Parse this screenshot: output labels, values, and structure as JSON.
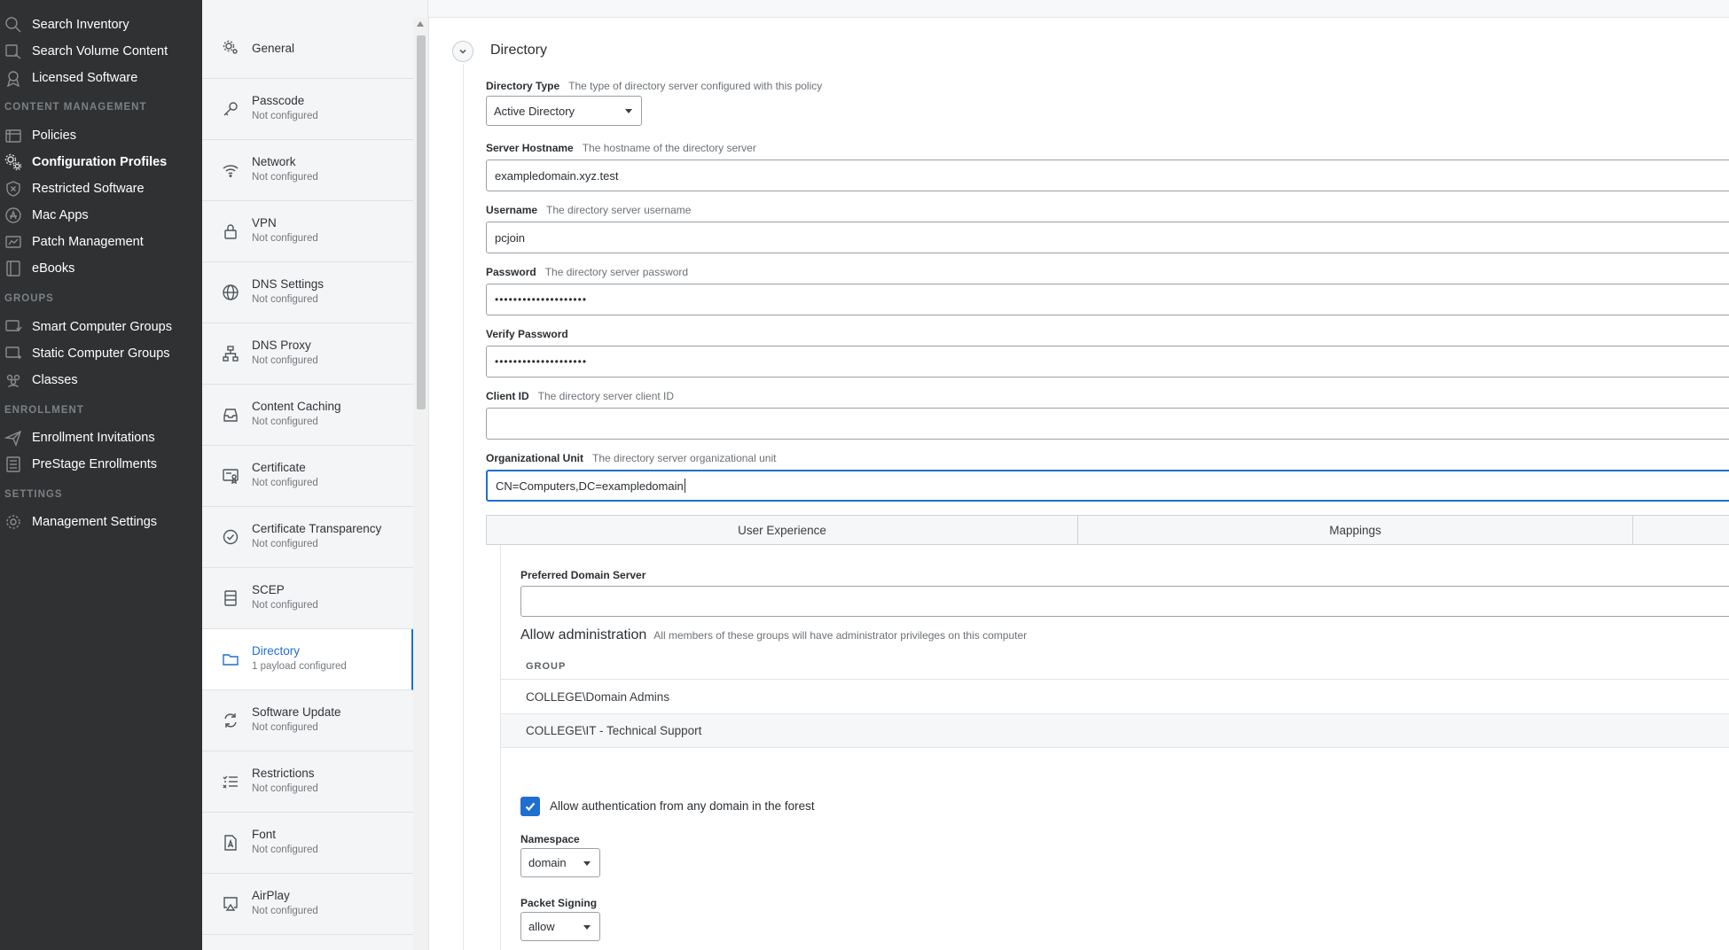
{
  "nav": {
    "items_top": [
      {
        "label": "Search Inventory",
        "icon": "search-icon"
      },
      {
        "label": "Search Volume Content",
        "icon": "search-volume-icon"
      },
      {
        "label": "Licensed Software",
        "icon": "license-icon"
      }
    ],
    "sections": [
      {
        "title": "CONTENT MANAGEMENT"
      },
      {
        "title": "GROUPS"
      },
      {
        "title": "ENROLLMENT"
      },
      {
        "title": "SETTINGS"
      }
    ],
    "content_management": [
      {
        "label": "Policies",
        "icon": "policies-icon"
      },
      {
        "label": "Configuration Profiles",
        "icon": "gears-icon",
        "active": true
      },
      {
        "label": "Restricted Software",
        "icon": "shield-x-icon"
      },
      {
        "label": "Mac Apps",
        "icon": "app-store-icon"
      },
      {
        "label": "Patch Management",
        "icon": "patch-icon"
      },
      {
        "label": "eBooks",
        "icon": "book-icon"
      }
    ],
    "groups": [
      {
        "label": "Smart Computer Groups",
        "icon": "smart-group-icon"
      },
      {
        "label": "Static Computer Groups",
        "icon": "static-group-icon"
      },
      {
        "label": "Classes",
        "icon": "classes-icon"
      }
    ],
    "enrollment": [
      {
        "label": "Enrollment Invitations",
        "icon": "paper-plane-icon"
      },
      {
        "label": "PreStage Enrollments",
        "icon": "list-icon"
      }
    ],
    "settings": [
      {
        "label": "Management Settings",
        "icon": "gear-icon"
      }
    ]
  },
  "payloads": [
    {
      "name": "General",
      "status": "",
      "icon": "gears-icon"
    },
    {
      "name": "Passcode",
      "status": "Not configured",
      "icon": "key-icon"
    },
    {
      "name": "Network",
      "status": "Not configured",
      "icon": "wifi-icon"
    },
    {
      "name": "VPN",
      "status": "Not configured",
      "icon": "lock-icon"
    },
    {
      "name": "DNS Settings",
      "status": "Not configured",
      "icon": "globe-icon"
    },
    {
      "name": "DNS Proxy",
      "status": "Not configured",
      "icon": "hierarchy-icon"
    },
    {
      "name": "Content Caching",
      "status": "Not configured",
      "icon": "inbox-icon"
    },
    {
      "name": "Certificate",
      "status": "Not configured",
      "icon": "certificate-icon"
    },
    {
      "name": "Certificate Transparency",
      "status": "Not configured",
      "icon": "check-circle-icon"
    },
    {
      "name": "SCEP",
      "status": "Not configured",
      "icon": "scep-icon"
    },
    {
      "name": "Directory",
      "status": "1 payload configured",
      "icon": "folder-icon",
      "active": true
    },
    {
      "name": "Software Update",
      "status": "Not configured",
      "icon": "refresh-icon"
    },
    {
      "name": "Restrictions",
      "status": "Not configured",
      "icon": "checklist-icon"
    },
    {
      "name": "Font",
      "status": "Not configured",
      "icon": "font-icon"
    },
    {
      "name": "AirPlay",
      "status": "Not configured",
      "icon": "airplay-icon"
    }
  ],
  "directory": {
    "title": "Directory",
    "directory_type": {
      "label": "Directory Type",
      "desc": "The type of directory server configured with this policy",
      "value": "Active Directory"
    },
    "server_hostname": {
      "label": "Server Hostname",
      "desc": "The hostname of the directory server",
      "value": "exampledomain.xyz.test"
    },
    "username": {
      "label": "Username",
      "desc": "The directory server username",
      "value": "pcjoin"
    },
    "password": {
      "label": "Password",
      "desc": "The directory server password",
      "value": "••••••••••••••••••••"
    },
    "verify_password": {
      "label": "Verify Password",
      "value": "••••••••••••••••••••"
    },
    "client_id": {
      "label": "Client ID",
      "desc": "The directory server client ID",
      "value": ""
    },
    "org_unit": {
      "label": "Organizational Unit",
      "desc": "The directory server organizational unit",
      "value": "CN=Computers,DC=exampledomain"
    }
  },
  "tabs": [
    "User Experience",
    "Mappings"
  ],
  "user_experience": {
    "preferred_server_label": "Preferred Domain Server",
    "preferred_server_value": "",
    "admin_title": "Allow administration",
    "admin_desc": "All members of these groups will have administrator privileges on this computer",
    "group_header": "GROUP",
    "groups": [
      "COLLEGE\\Domain Admins",
      "COLLEGE\\IT - Technical Support"
    ],
    "forest_label": "Allow authentication from any domain in the forest",
    "forest_checked": true,
    "namespace_label": "Namespace",
    "namespace_value": "domain",
    "packet_signing_label": "Packet Signing",
    "packet_signing_value": "allow"
  },
  "colors": {
    "accent": "#1f6fd1",
    "nav_bg": "#2f3133"
  }
}
